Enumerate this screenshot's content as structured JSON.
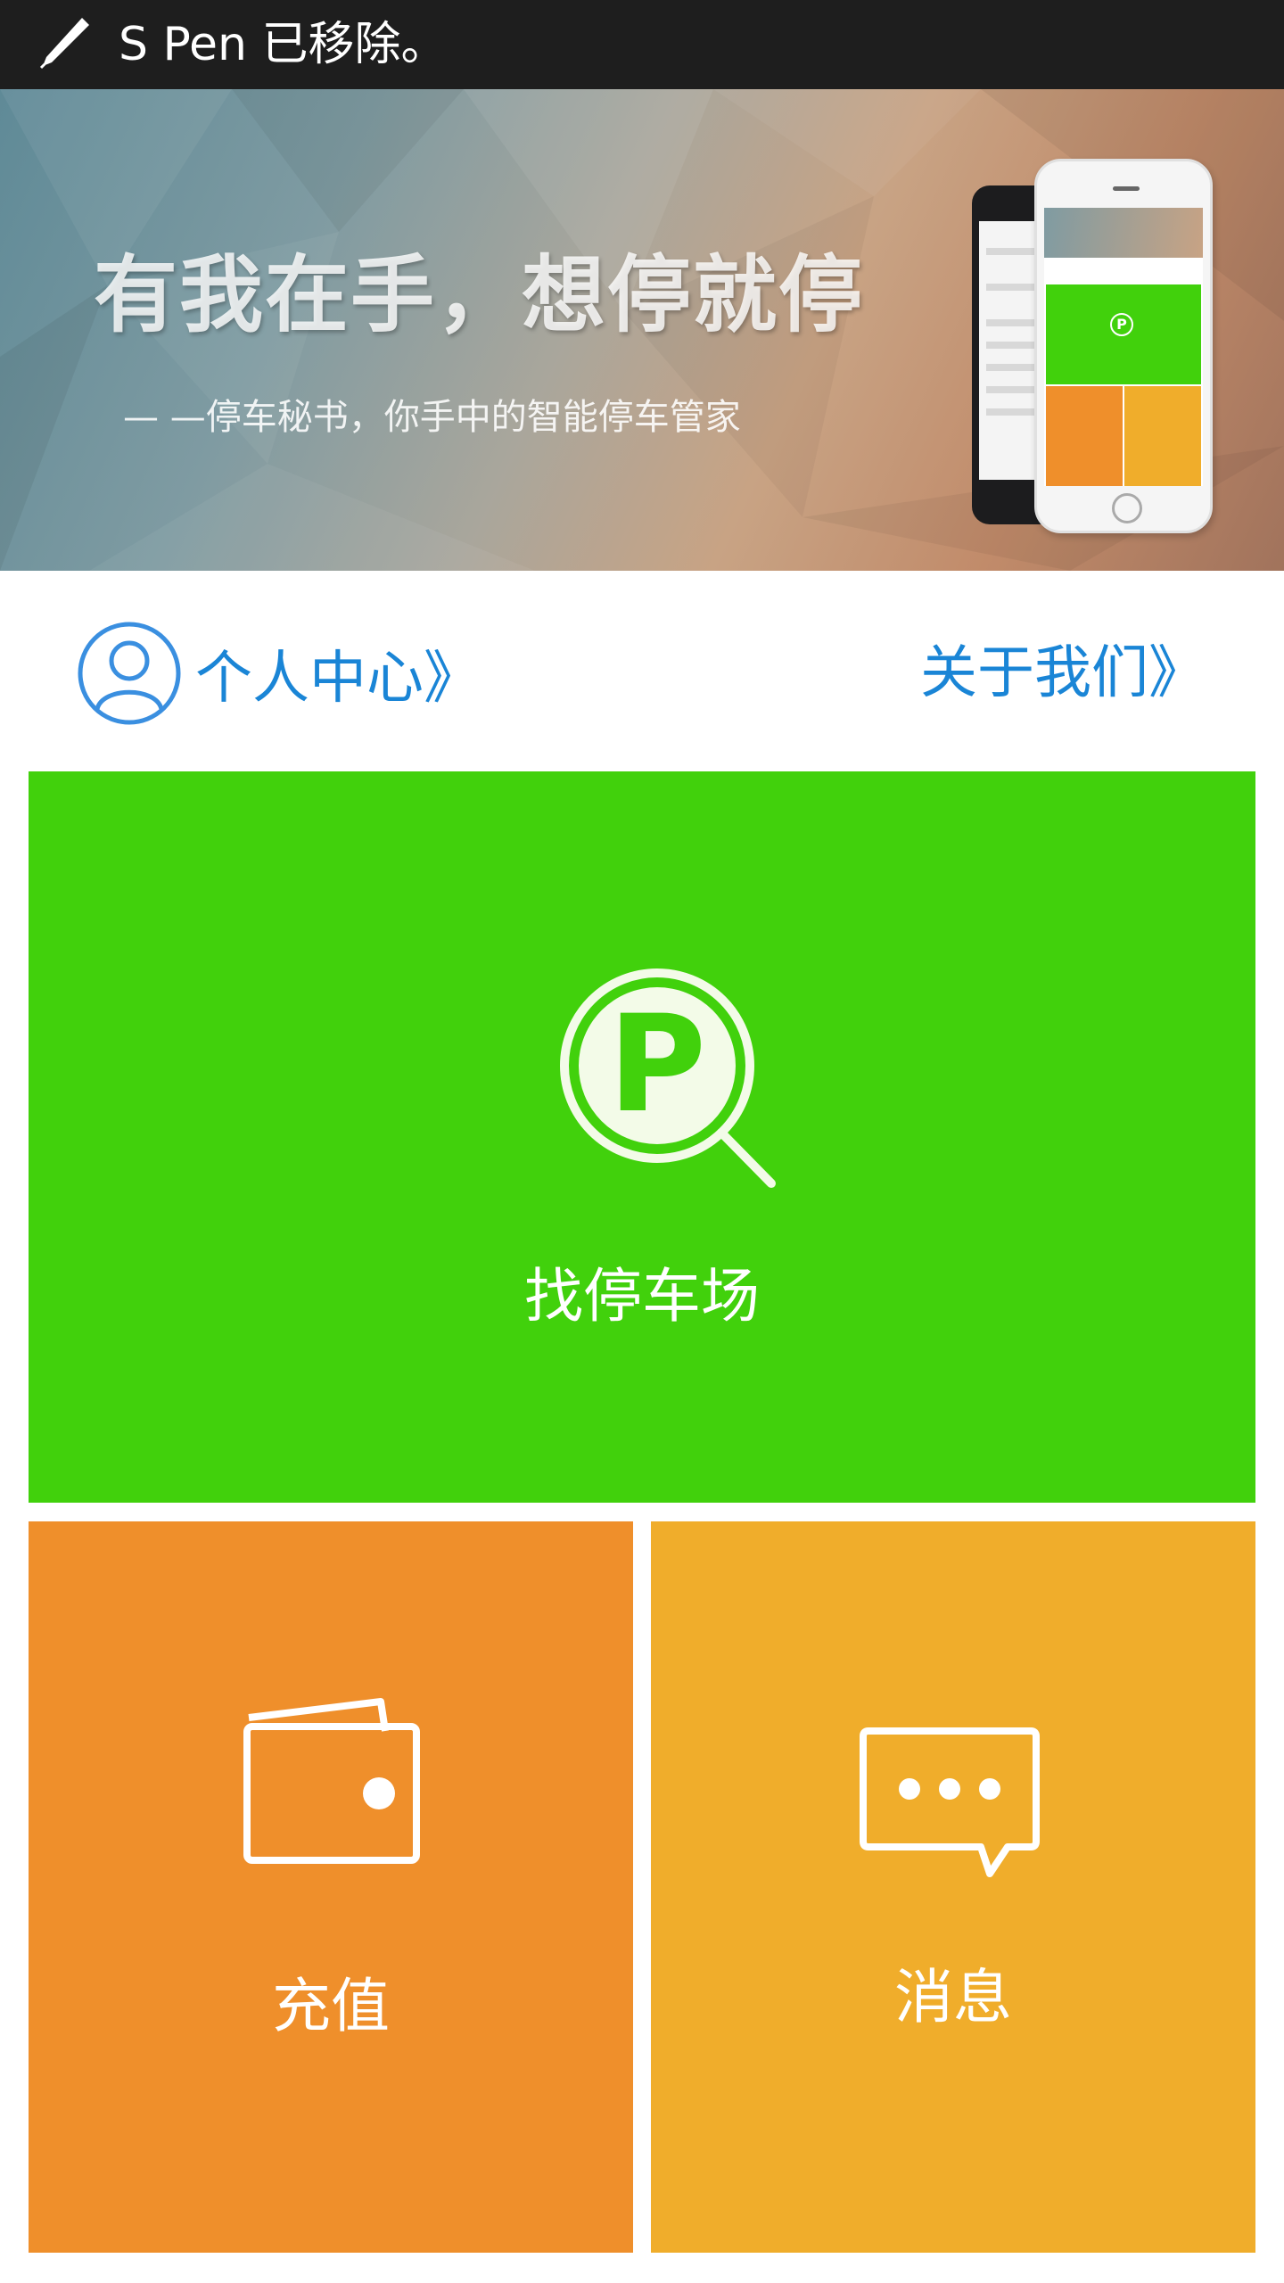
{
  "status_bar": {
    "notification_text": "S Pen 已移除。",
    "icon": "s-pen-icon"
  },
  "banner": {
    "headline": "有我在手，想停就停",
    "subline": "— —停车秘书，你手中的智能停车管家"
  },
  "nav": {
    "profile_label": "个人中心》",
    "profile_icon": "avatar-icon",
    "about_label": "关于我们》"
  },
  "tiles": {
    "find_parking": {
      "label": "找停车场",
      "icon": "parking-search-icon",
      "color": "#41d10c"
    },
    "recharge": {
      "label": "充值",
      "icon": "wallet-icon",
      "color": "#ef8f2b"
    },
    "messages": {
      "label": "消息",
      "icon": "message-icon",
      "color": "#f0ad2b"
    }
  },
  "colors": {
    "accent_blue": "#1a85d6",
    "status_bar": "#1e1e1e"
  }
}
